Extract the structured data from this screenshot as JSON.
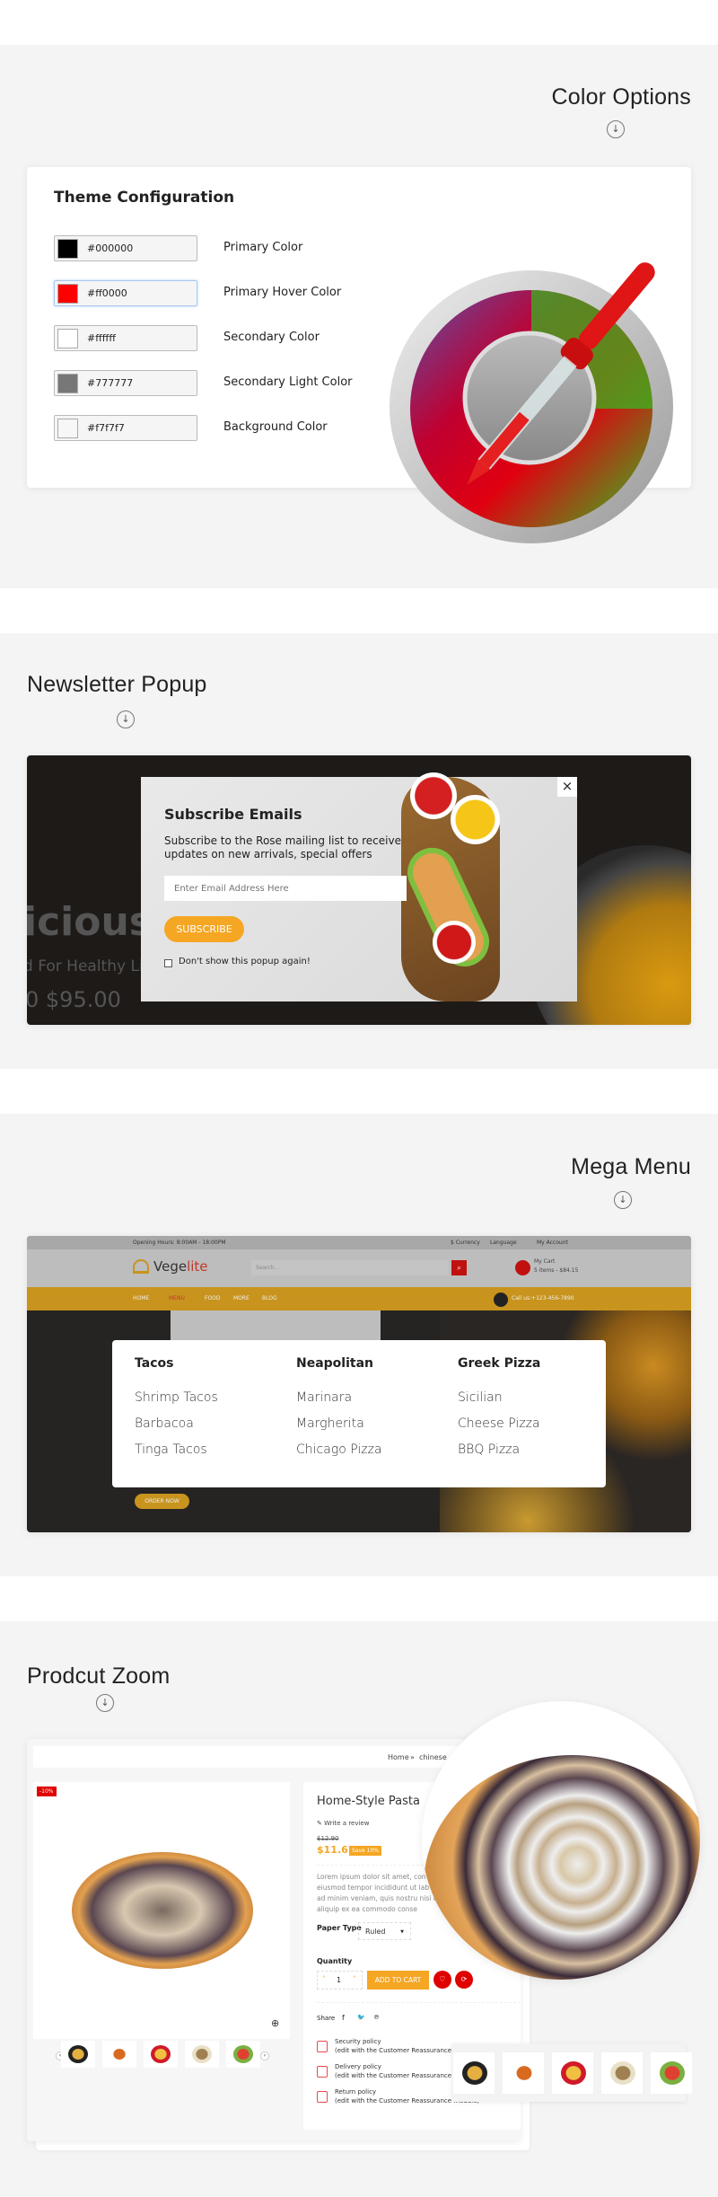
{
  "color_options": {
    "title": "Color Options",
    "config_title": "Theme Configuration",
    "rows": [
      {
        "hex": "#000000",
        "label": "Primary Color",
        "swatch": "#000000"
      },
      {
        "hex": "#ff0000",
        "label": "Primary Hover Color",
        "swatch": "#ff0000"
      },
      {
        "hex": "#ffffff",
        "label": "Secondary Color",
        "swatch": "#ffffff"
      },
      {
        "hex": "#777777",
        "label": "Secondary Light Color",
        "swatch": "#777777"
      },
      {
        "hex": "#f7f7f7",
        "label": "Background Color",
        "swatch": "#f7f7f7"
      }
    ]
  },
  "newsletter": {
    "title": "Newsletter Popup",
    "popup_title": "Subscribe Emails",
    "popup_text": "Subscribe to the Rose mailing list to receive updates on new arrivals, special offers",
    "email_placeholder": "Enter Email Address Here",
    "subscribe_label": "SUBSCRIBE",
    "dont_show_label": "Don't show this popup again!",
    "close_label": "×",
    "hero_word": "icious",
    "hero_sub": "d For Healthy Li",
    "hero_price": "0 $95.00",
    "accent": "#f5a623"
  },
  "mega_menu": {
    "title": "Mega Menu",
    "topbar": {
      "hours": "Opening Hours: 8:00AM - 18:00PM",
      "currency": "$ Currency",
      "language": "Language",
      "account": "My Account"
    },
    "logo": {
      "part1": "Vege",
      "part2": "lite"
    },
    "search_placeholder": "Search...",
    "cart": {
      "label": "My Cart",
      "summary": "5 items - $84.15"
    },
    "nav": [
      "HOME",
      "MENU",
      "FOOD",
      "MORE",
      "BLOG"
    ],
    "call": "Call us:+123-456-7890",
    "order_now": "ORDER NOW",
    "columns": [
      {
        "heading": "Tacos",
        "items": [
          "Shrimp Tacos",
          "Barbacoa",
          "Tinga Tacos"
        ]
      },
      {
        "heading": "Neapolitan",
        "items": [
          "Marinara",
          "Margherita",
          "Chicago Pizza"
        ]
      },
      {
        "heading": "Greek Pizza",
        "items": [
          "Sicilian",
          "Cheese Pizza",
          "BBQ Pizza"
        ]
      }
    ],
    "nav_color": "#c8941e"
  },
  "product_zoom": {
    "title": "Prodcut Zoom",
    "breadcrumb": [
      "Home",
      "chinese"
    ],
    "discount_badge": "-10%",
    "name": "Home-Style Pasta",
    "write_review": "Write a review",
    "old_price": "$12.90",
    "price": "$11.61",
    "save_badge": "Save 10%",
    "description": "Lorem ipsum dolor sit amet, con eiusmod tempor incididunt ut lab enim ad minim veniam, quis nostru nisi ut aliquip ex ea commodo conse",
    "paper_type_label": "Paper Type",
    "paper_type_value": "Ruled",
    "quantity_label": "Quantity",
    "quantity_value": "1",
    "add_to_cart": "ADD TO CART",
    "share_label": "Share",
    "policies": [
      {
        "title": "Security policy",
        "text": "(edit with the Customer Reassurance m"
      },
      {
        "title": "Delivery policy",
        "text": "(edit with the Customer Reassurance m"
      },
      {
        "title": "Return policy",
        "text": "(edit with the Customer Reassurance module)"
      }
    ],
    "price_color": "#f5a623",
    "action_color": "#e00000"
  }
}
